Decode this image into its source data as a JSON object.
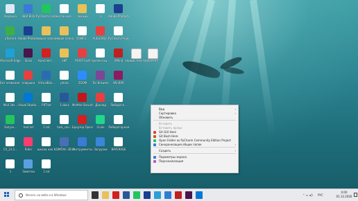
{
  "desktop": {
    "icons": [
      {
        "label": "Корзина",
        "icon": "recycle-bin-icon",
        "color": "#dfe9f5"
      },
      {
        "label": "Wolf Blitz",
        "icon": "app-icon",
        "color": "#3a7bd5"
      },
      {
        "label": "PyCharm Communi...",
        "icon": "pycharm-icon",
        "color": "#22c55e"
      },
      {
        "label": "экспансия...",
        "icon": "document-icon",
        "color": "#ffffff"
      },
      {
        "label": "лекции",
        "icon": "folder-icon",
        "color": "#e8c15a"
      },
      {
        "label": "1",
        "icon": "document-icon",
        "color": "#ffffff"
      },
      {
        "label": "Adobe Photosh...",
        "icon": "photoshop-icon",
        "color": "#1c3f8f"
      },
      {
        "label": "uTorrent",
        "icon": "utorrent-icon",
        "color": "#3cb043"
      },
      {
        "label": "Adobe Photosh...",
        "icon": "photoshop-icon",
        "color": "#1c3f8f"
      },
      {
        "label": "новая папка",
        "icon": "folder-icon",
        "color": "#e8c15a"
      },
      {
        "label": "Новая папка",
        "icon": "folder-icon",
        "color": "#e8c15a"
      },
      {
        "label": "OSMF2...",
        "icon": "document-icon",
        "color": "#ffffff"
      },
      {
        "label": "AutoCADJ...",
        "icon": "pdf-icon",
        "color": "#e84040"
      },
      {
        "label": "PyCharm Projects",
        "icon": "document-icon",
        "color": "#ffffff"
      },
      {
        "label": "Microsoft Edge",
        "icon": "edge-icon",
        "color": "#1fa0d8"
      },
      {
        "label": "Slack",
        "icon": "slack-icon",
        "color": "#4a154b"
      },
      {
        "label": "Конспект...",
        "icon": "opera-icon",
        "color": "#d32020"
      },
      {
        "label": "ЗИТ",
        "icon": "folder-icon",
        "color": "#e8c15a"
      },
      {
        "label": "PDFFFF.pdf",
        "icon": "pdf-icon",
        "color": "#e84040"
      },
      {
        "label": "презентац...",
        "icon": "document-icon",
        "color": "#ffffff"
      },
      {
        "label": "XMind",
        "icon": "xmind-icon",
        "color": "#c02020"
      },
      {
        "label": "Без названия...",
        "icon": "document-icon",
        "color": "#ffffff"
      },
      {
        "label": "ловушки",
        "icon": "pdf-icon",
        "color": "#e84040"
      },
      {
        "label": "VirtualBox...",
        "icon": "virtualbox-icon",
        "color": "#2a6cb0"
      },
      {
        "label": "photo",
        "icon": "document-icon",
        "color": "#ffffff"
      },
      {
        "label": "ZOOM",
        "icon": "zoom-icon",
        "color": "#2d8cff"
      },
      {
        "label": "Tor Browser",
        "icon": "tor-icon",
        "color": "#7d4698"
      },
      {
        "label": "WinRAR",
        "icon": "winrar-icon",
        "color": "#8b1c62"
      },
      {
        "label": "Mall 3ds...",
        "icon": "document-icon",
        "color": "#ffffff"
      },
      {
        "label": "Visual Studio...",
        "icon": "vscode-icon",
        "color": "#0078d4"
      },
      {
        "label": "PRT.txt",
        "icon": "document-icon",
        "color": "#ffffff"
      },
      {
        "label": "1.docx",
        "icon": "word-icon",
        "color": "#2b579a"
      },
      {
        "label": "McAfee Security",
        "icon": "mcafee-icon",
        "color": "#c01818"
      },
      {
        "label": "Доклад",
        "icon": "pdf-icon",
        "color": "#e84040"
      },
      {
        "label": "Лаборато...",
        "icon": "document-icon",
        "color": "#ffffff"
      },
      {
        "label": "Запуск...",
        "icon": "pycharm-icon",
        "color": "#22c55e"
      },
      {
        "label": "text.txt",
        "icon": "document-icon",
        "color": "#ffffff"
      },
      {
        "label": "1.txt",
        "icon": "document-icon",
        "color": "#ffffff"
      },
      {
        "label": "task_con...",
        "icon": "document-icon",
        "color": "#ffffff"
      },
      {
        "label": "Браузер Opera",
        "icon": "opera-icon",
        "color": "#d32020"
      },
      {
        "label": "CLion",
        "icon": "clion-icon",
        "color": "#21d789"
      },
      {
        "label": "Лабораторная...",
        "icon": "document-icon",
        "color": "#ffffff"
      },
      {
        "label": "CV_23.1...",
        "icon": "document-icon",
        "color": "#ffffff"
      },
      {
        "label": "Rider",
        "icon": "rider-icon",
        "color": "#ff3c6e"
      },
      {
        "label": "школа нал...",
        "icon": "document-icon",
        "color": "#ffffff"
      },
      {
        "label": "КОМПАС-3D Viewer v19",
        "icon": "kompas-icon",
        "color": "#4a6fb5"
      },
      {
        "label": "Инструменты...",
        "icon": "app-icon",
        "color": "#3a7bd5"
      },
      {
        "label": "Загрузки",
        "icon": "downloads-icon",
        "color": "#3a86d8"
      },
      {
        "label": "BAYERAGE",
        "icon": "document-icon",
        "color": "#ffffff"
      },
      {
        "label": "1",
        "icon": "document-icon",
        "color": "#ffffff"
      },
      {
        "label": "Заметки",
        "icon": "notes-icon",
        "color": "#5aa0e0"
      },
      {
        "label": "1.txt",
        "icon": "document-icon",
        "color": "#ffffff"
      }
    ],
    "floating_icons": [
      {
        "label": "Новый текстовый",
        "icon": "text-file-icon"
      },
      {
        "label": "ИЗУУАТ",
        "icon": "text-file-icon"
      }
    ]
  },
  "context_menu": {
    "items": [
      {
        "label": "Вид",
        "submenu": true
      },
      {
        "label": "Сортировка",
        "submenu": true
      },
      {
        "label": "Обновить",
        "submenu": false
      },
      {
        "separator": true
      },
      {
        "label": "Вставить",
        "disabled": true
      },
      {
        "label": "Вставить ярлык",
        "disabled": true
      },
      {
        "label": "Git GUI Here",
        "icon": "git-icon"
      },
      {
        "label": "Git Bash Here",
        "icon": "git-icon"
      },
      {
        "label": "Open Folder as PyCharm Community Edition Project",
        "icon": "pycharm-icon"
      },
      {
        "label": "Синхронизация общих папок",
        "icon": "sync-icon",
        "submenu": true
      },
      {
        "separator": true
      },
      {
        "label": "Создать",
        "submenu": true
      },
      {
        "separator": true
      },
      {
        "label": "Параметры экрана",
        "icon": "display-icon"
      },
      {
        "label": "Персонализация",
        "icon": "personalize-icon"
      }
    ]
  },
  "taskbar": {
    "search_placeholder": "Искать на вебе и в Windows",
    "tray_lang": "РУС",
    "clock_time": "0:00",
    "clock_date": "01.12.2020",
    "pinned": [
      {
        "icon": "task-view-icon",
        "color": "#333333"
      },
      {
        "icon": "file-explorer-icon",
        "color": "#e8c15a"
      },
      {
        "icon": "opera-icon",
        "color": "#d32020"
      },
      {
        "icon": "store-icon",
        "color": "#2b579a"
      },
      {
        "icon": "pycharm-icon",
        "color": "#22c55e"
      },
      {
        "icon": "photoshop-icon",
        "color": "#1c3f8f"
      },
      {
        "icon": "telegram-icon",
        "color": "#2aa0d8"
      },
      {
        "icon": "mail-icon",
        "color": "#2d7dd2"
      },
      {
        "icon": "xmind-icon",
        "color": "#c02020"
      },
      {
        "icon": "slack-icon",
        "color": "#4a154b"
      },
      {
        "icon": "vscode-icon",
        "color": "#0078d4"
      }
    ]
  }
}
